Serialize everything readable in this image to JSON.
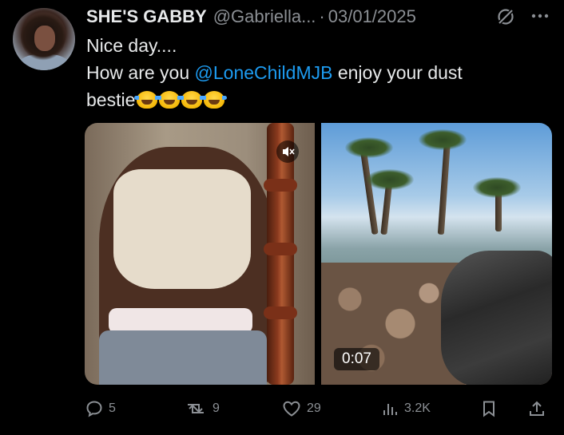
{
  "author": {
    "name": "SHE'S GABBY",
    "handle": "@Gabriella...",
    "separator": "·",
    "date": "03/01/2025"
  },
  "post": {
    "line1": "Nice day....",
    "line2_prefix": "How are you ",
    "mention": "@LoneChildMJB",
    "line2_suffix": " enjoy your dust",
    "line3": "bestie",
    "emoji_count": 4
  },
  "media": {
    "left_icon": "mute-icon",
    "right_timer": "0:07"
  },
  "actions": {
    "replies": "5",
    "reposts": "9",
    "likes": "29",
    "views": "3.2K"
  },
  "colors": {
    "background": "#000000",
    "text": "#e7e9ea",
    "muted": "#8b8f94",
    "link": "#1d9bf0"
  }
}
